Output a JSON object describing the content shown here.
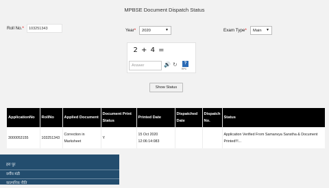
{
  "page": {
    "title": "MPBSE Document Dispatch Status"
  },
  "form": {
    "roll_label": "Roll No.",
    "roll_value": "103251343",
    "year_label": "Year",
    "year_value": "2020",
    "exam_type_label": "Exam Type",
    "exam_type_value": "Main",
    "required_mark": "*"
  },
  "captcha": {
    "question": "2 + 4 =",
    "answer_placeholder": "Answer",
    "help_glyph": "?",
    "provider_text": "RPC"
  },
  "button": {
    "show_status": "Show Status"
  },
  "table": {
    "headers": [
      "ApplicationNo",
      "RollNo",
      "Applied Document",
      "Document Print Status",
      "Printed Date",
      "Dispatched Date",
      "Dispatch No.",
      "Status"
    ],
    "rows": [
      [
        "3000053155",
        "103251343",
        "Correction in Marksheet",
        "Y",
        "15 Oct 2020 12:06:14:083",
        "",
        "",
        "Application Verified From Samanvya Sanstha & Document Printed!!!..."
      ]
    ]
  },
  "side_menu": {
    "items": [
      "हरा पुर",
      "वर्गीय मंडी",
      "काल्पनिक नीति"
    ]
  }
}
